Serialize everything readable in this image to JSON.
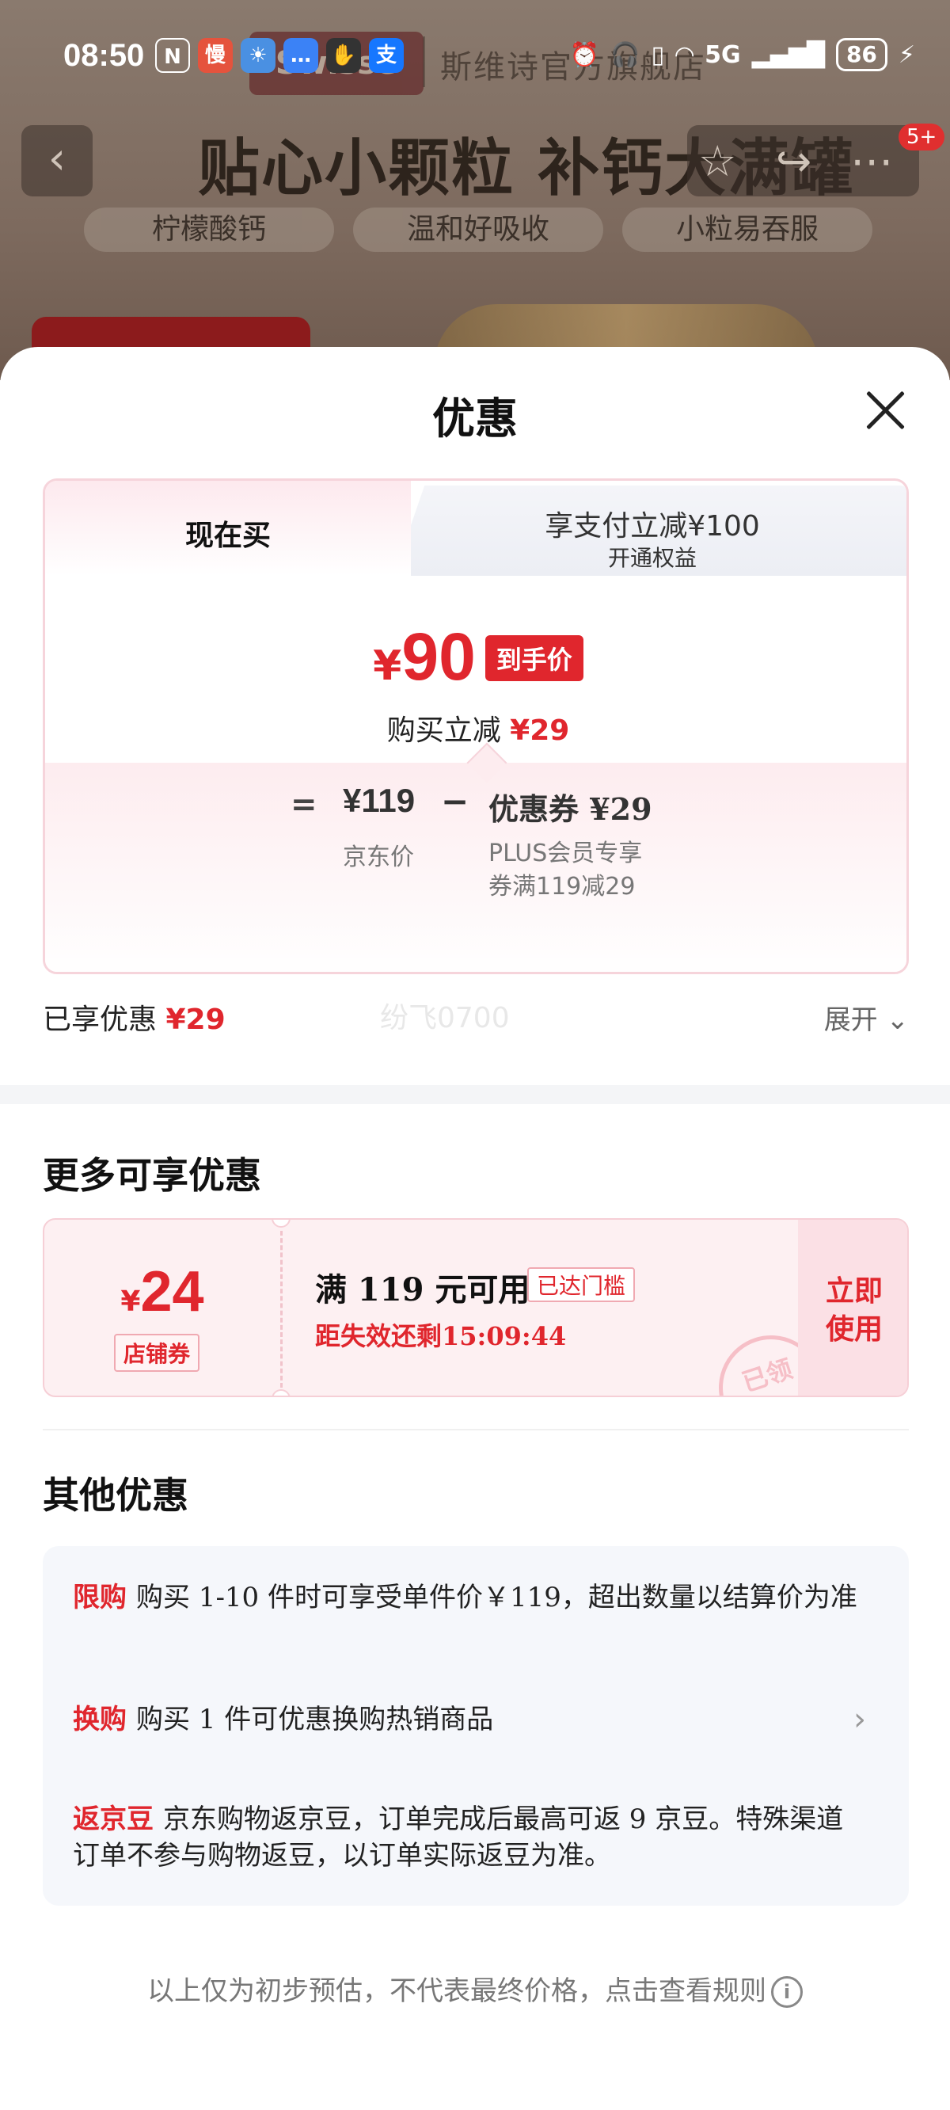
{
  "status_bar": {
    "time": "08:50",
    "battery": "86",
    "network": "5G"
  },
  "background_page": {
    "logo_text": "Swisse",
    "shop_name": "斯维诗官方旗舰店",
    "headline": "贴心小颗粒 补钙大满罐",
    "tags": [
      "柠檬酸钙",
      "温和好吸收",
      "小粒易吞服"
    ],
    "message_badge": "5+"
  },
  "sheet": {
    "title": "优惠",
    "tabs": {
      "now_label": "现在买",
      "other_main": "享支付立减¥100",
      "other_sub": "开通权益"
    },
    "price": {
      "currency": "¥",
      "final": "90",
      "final_tag": "到手价",
      "reduce_label": "购买立减",
      "reduce_amount": "¥29"
    },
    "calc": {
      "equals": "=",
      "jd_price": "¥119",
      "minus": "−",
      "coupon": "优惠券 ¥29",
      "jd_price_label": "京东价",
      "coupon_desc": "PLUS会员专享券满119减29"
    },
    "enjoyed": {
      "label": "已享优惠",
      "amount": "¥29",
      "watermark": "纷飞0700",
      "expand": "展开"
    },
    "more_title": "更多可享优惠",
    "coupon": {
      "currency": "¥",
      "amount": "24",
      "type": "店铺券",
      "condition": "满 119 元可用",
      "met": "已达门槛",
      "expiry": "距失效还剩15:09:44",
      "stamp": "已领",
      "use_line1": "立即",
      "use_line2": "使用"
    },
    "other_title": "其他优惠",
    "offers": [
      {
        "tag": "限购",
        "text": "购买 1-10 件时可享受单件价￥119，超出数量以结算价为准"
      },
      {
        "tag": "换购",
        "text": "购买 1 件可优惠换购热销商品"
      },
      {
        "tag": "返京豆",
        "text": "京东购物返京豆，订单完成后最高可返 9 京豆。特殊渠道订单不参与购物返豆，以订单实际返豆为准。"
      }
    ],
    "footer": "以上仅为初步预估，不代表最终价格，点击查看规则"
  }
}
